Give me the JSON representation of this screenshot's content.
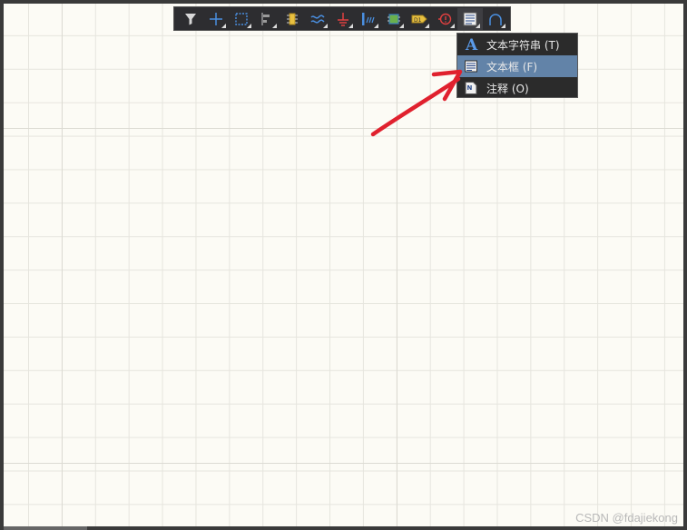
{
  "toolbar": {
    "tools": [
      {
        "name": "filter-icon"
      },
      {
        "name": "crosshair-icon"
      },
      {
        "name": "select-rect-icon"
      },
      {
        "name": "align-icon"
      },
      {
        "name": "component-icon"
      },
      {
        "name": "wire-icon"
      },
      {
        "name": "ground-icon"
      },
      {
        "name": "bus-icon"
      },
      {
        "name": "sheet-icon"
      },
      {
        "name": "port-icon"
      },
      {
        "name": "directive-icon"
      },
      {
        "name": "text-tool-icon"
      },
      {
        "name": "arc-icon"
      }
    ]
  },
  "menu": {
    "items": [
      {
        "icon": "text-string-icon",
        "label": "文本字符串 (T)"
      },
      {
        "icon": "text-frame-icon",
        "label": "文本框 (F)"
      },
      {
        "icon": "note-icon",
        "label": "注释 (O)"
      }
    ]
  },
  "watermark": "CSDN @fdajiekong",
  "colors": {
    "canvas": "#fcfbf5",
    "grid": "#e6e5de",
    "toolbar_bg": "#2d2d30",
    "menu_selected": "#6283a8",
    "arrow": "#e0212e"
  }
}
